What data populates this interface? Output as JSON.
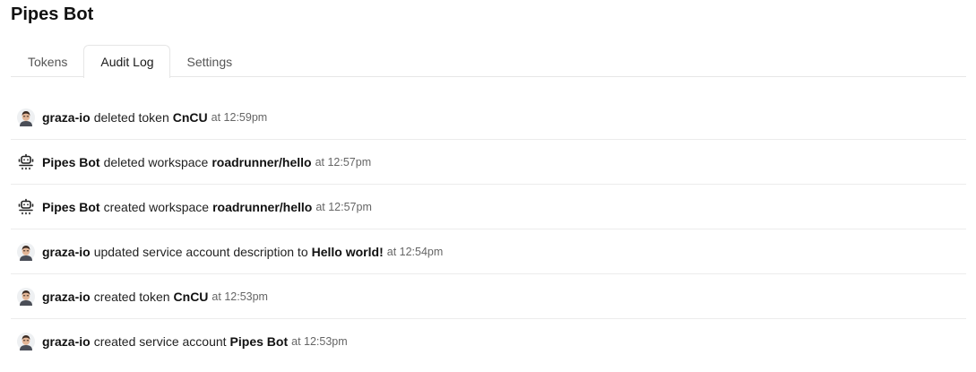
{
  "page": {
    "title": "Pipes Bot"
  },
  "tabs": [
    {
      "label": "Tokens",
      "active": false
    },
    {
      "label": "Audit Log",
      "active": true
    },
    {
      "label": "Settings",
      "active": false
    }
  ],
  "audit_log": [
    {
      "avatar": "user-avatar-icon",
      "actor": "graza-io",
      "action": "deleted token",
      "object": "CnCU",
      "time": "at 12:59pm"
    },
    {
      "avatar": "robot-icon",
      "actor": "Pipes Bot",
      "action": "deleted workspace",
      "object": "roadrunner/hello",
      "time": "at 12:57pm"
    },
    {
      "avatar": "robot-icon",
      "actor": "Pipes Bot",
      "action": "created workspace",
      "object": "roadrunner/hello",
      "time": "at 12:57pm"
    },
    {
      "avatar": "user-avatar-icon",
      "actor": "graza-io",
      "action": "updated service account description to",
      "object": "Hello world!",
      "time": "at 12:54pm"
    },
    {
      "avatar": "user-avatar-icon",
      "actor": "graza-io",
      "action": "created token",
      "object": "CnCU",
      "time": "at 12:53pm"
    },
    {
      "avatar": "user-avatar-icon",
      "actor": "graza-io",
      "action": "created service account",
      "object": "Pipes Bot",
      "time": "at 12:53pm"
    }
  ]
}
